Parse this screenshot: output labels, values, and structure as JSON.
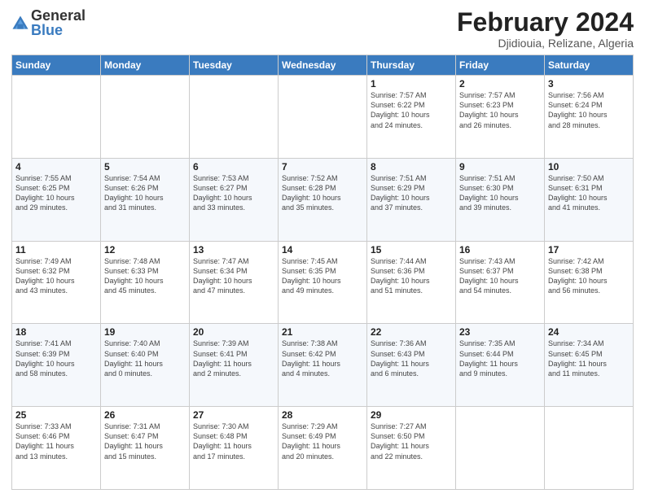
{
  "logo": {
    "general": "General",
    "blue": "Blue"
  },
  "title": "February 2024",
  "location": "Djidiouia, Relizane, Algeria",
  "days_header": [
    "Sunday",
    "Monday",
    "Tuesday",
    "Wednesday",
    "Thursday",
    "Friday",
    "Saturday"
  ],
  "weeks": [
    [
      {
        "num": "",
        "detail": ""
      },
      {
        "num": "",
        "detail": ""
      },
      {
        "num": "",
        "detail": ""
      },
      {
        "num": "",
        "detail": ""
      },
      {
        "num": "1",
        "detail": "Sunrise: 7:57 AM\nSunset: 6:22 PM\nDaylight: 10 hours\nand 24 minutes."
      },
      {
        "num": "2",
        "detail": "Sunrise: 7:57 AM\nSunset: 6:23 PM\nDaylight: 10 hours\nand 26 minutes."
      },
      {
        "num": "3",
        "detail": "Sunrise: 7:56 AM\nSunset: 6:24 PM\nDaylight: 10 hours\nand 28 minutes."
      }
    ],
    [
      {
        "num": "4",
        "detail": "Sunrise: 7:55 AM\nSunset: 6:25 PM\nDaylight: 10 hours\nand 29 minutes."
      },
      {
        "num": "5",
        "detail": "Sunrise: 7:54 AM\nSunset: 6:26 PM\nDaylight: 10 hours\nand 31 minutes."
      },
      {
        "num": "6",
        "detail": "Sunrise: 7:53 AM\nSunset: 6:27 PM\nDaylight: 10 hours\nand 33 minutes."
      },
      {
        "num": "7",
        "detail": "Sunrise: 7:52 AM\nSunset: 6:28 PM\nDaylight: 10 hours\nand 35 minutes."
      },
      {
        "num": "8",
        "detail": "Sunrise: 7:51 AM\nSunset: 6:29 PM\nDaylight: 10 hours\nand 37 minutes."
      },
      {
        "num": "9",
        "detail": "Sunrise: 7:51 AM\nSunset: 6:30 PM\nDaylight: 10 hours\nand 39 minutes."
      },
      {
        "num": "10",
        "detail": "Sunrise: 7:50 AM\nSunset: 6:31 PM\nDaylight: 10 hours\nand 41 minutes."
      }
    ],
    [
      {
        "num": "11",
        "detail": "Sunrise: 7:49 AM\nSunset: 6:32 PM\nDaylight: 10 hours\nand 43 minutes."
      },
      {
        "num": "12",
        "detail": "Sunrise: 7:48 AM\nSunset: 6:33 PM\nDaylight: 10 hours\nand 45 minutes."
      },
      {
        "num": "13",
        "detail": "Sunrise: 7:47 AM\nSunset: 6:34 PM\nDaylight: 10 hours\nand 47 minutes."
      },
      {
        "num": "14",
        "detail": "Sunrise: 7:45 AM\nSunset: 6:35 PM\nDaylight: 10 hours\nand 49 minutes."
      },
      {
        "num": "15",
        "detail": "Sunrise: 7:44 AM\nSunset: 6:36 PM\nDaylight: 10 hours\nand 51 minutes."
      },
      {
        "num": "16",
        "detail": "Sunrise: 7:43 AM\nSunset: 6:37 PM\nDaylight: 10 hours\nand 54 minutes."
      },
      {
        "num": "17",
        "detail": "Sunrise: 7:42 AM\nSunset: 6:38 PM\nDaylight: 10 hours\nand 56 minutes."
      }
    ],
    [
      {
        "num": "18",
        "detail": "Sunrise: 7:41 AM\nSunset: 6:39 PM\nDaylight: 10 hours\nand 58 minutes."
      },
      {
        "num": "19",
        "detail": "Sunrise: 7:40 AM\nSunset: 6:40 PM\nDaylight: 11 hours\nand 0 minutes."
      },
      {
        "num": "20",
        "detail": "Sunrise: 7:39 AM\nSunset: 6:41 PM\nDaylight: 11 hours\nand 2 minutes."
      },
      {
        "num": "21",
        "detail": "Sunrise: 7:38 AM\nSunset: 6:42 PM\nDaylight: 11 hours\nand 4 minutes."
      },
      {
        "num": "22",
        "detail": "Sunrise: 7:36 AM\nSunset: 6:43 PM\nDaylight: 11 hours\nand 6 minutes."
      },
      {
        "num": "23",
        "detail": "Sunrise: 7:35 AM\nSunset: 6:44 PM\nDaylight: 11 hours\nand 9 minutes."
      },
      {
        "num": "24",
        "detail": "Sunrise: 7:34 AM\nSunset: 6:45 PM\nDaylight: 11 hours\nand 11 minutes."
      }
    ],
    [
      {
        "num": "25",
        "detail": "Sunrise: 7:33 AM\nSunset: 6:46 PM\nDaylight: 11 hours\nand 13 minutes."
      },
      {
        "num": "26",
        "detail": "Sunrise: 7:31 AM\nSunset: 6:47 PM\nDaylight: 11 hours\nand 15 minutes."
      },
      {
        "num": "27",
        "detail": "Sunrise: 7:30 AM\nSunset: 6:48 PM\nDaylight: 11 hours\nand 17 minutes."
      },
      {
        "num": "28",
        "detail": "Sunrise: 7:29 AM\nSunset: 6:49 PM\nDaylight: 11 hours\nand 20 minutes."
      },
      {
        "num": "29",
        "detail": "Sunrise: 7:27 AM\nSunset: 6:50 PM\nDaylight: 11 hours\nand 22 minutes."
      },
      {
        "num": "",
        "detail": ""
      },
      {
        "num": "",
        "detail": ""
      }
    ]
  ]
}
